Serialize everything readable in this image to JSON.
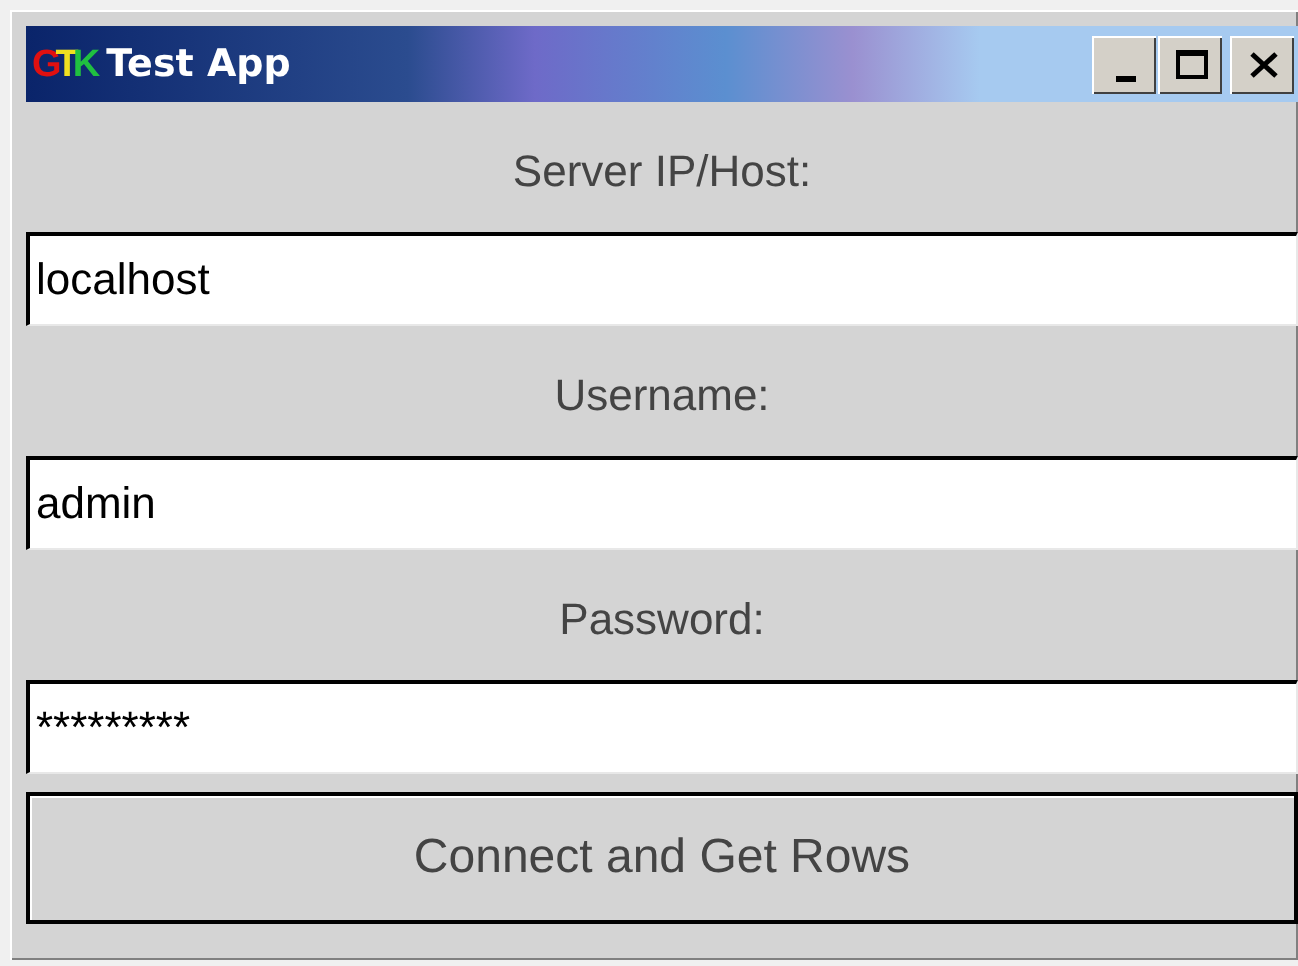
{
  "window": {
    "title": "Test App",
    "icon_text": "GTK"
  },
  "form": [
    {
      "label": "Server IP/Host:",
      "value": "localhost"
    },
    {
      "label": "Username:",
      "value": "admin"
    },
    {
      "label": "Password:",
      "value": "*********"
    }
  ],
  "buttons": [
    "Connect and Get Rows"
  ]
}
